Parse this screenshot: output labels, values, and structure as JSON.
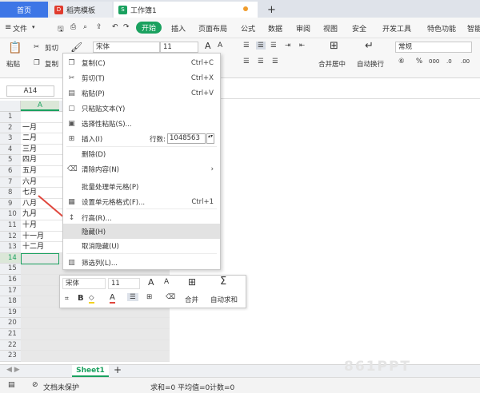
{
  "tabs": {
    "home": "首页",
    "template": "稻壳模板",
    "workbook": "工作簿1",
    "add": "+",
    "tpl_icon": "D",
    "wb_icon": "S"
  },
  "menubar": {
    "file": "文件",
    "start": "开始",
    "items": [
      "插入",
      "页面布局",
      "公式",
      "数据",
      "审阅",
      "视图",
      "安全",
      "开发工具",
      "特色功能",
      "智能"
    ]
  },
  "ribbon": {
    "paste": "粘贴",
    "cut": "剪切",
    "copy": "复制",
    "font_name": "宋体",
    "font_size": "11",
    "font_grow": "A",
    "font_shrink": "A",
    "merge": "合并居中",
    "wrap": "自动换行",
    "number_format": "常规",
    "percent": "%",
    "thousands": "000"
  },
  "formula": {
    "cell_ref": "A14"
  },
  "grid": {
    "col_a": "A",
    "rows": [
      "1",
      "2",
      "3",
      "4",
      "5",
      "6",
      "7",
      "8",
      "9",
      "10",
      "11",
      "12",
      "13",
      "14",
      "15",
      "16",
      "17",
      "18",
      "19",
      "20",
      "21",
      "22",
      "23"
    ],
    "values": [
      "",
      "一月",
      "二月",
      "三月",
      "四月",
      "五月",
      "六月",
      "七月",
      "八月",
      "九月",
      "十月",
      "十一月",
      "十二月",
      "",
      "",
      "",
      "",
      "",
      "",
      "",
      "",
      "",
      ""
    ]
  },
  "context_menu": {
    "items": [
      {
        "icon": "copy-icon",
        "glyph": "❐",
        "label": "复制(C)",
        "shortcut": "Ctrl+C"
      },
      {
        "icon": "scissors-icon",
        "glyph": "✂",
        "label": "剪切(T)",
        "shortcut": "Ctrl+X"
      },
      {
        "icon": "paste-icon",
        "glyph": "▤",
        "label": "粘贴(P)",
        "shortcut": "Ctrl+V"
      },
      {
        "icon": "paste-text-icon",
        "glyph": "▢",
        "label": "只粘贴文本(Y)",
        "shortcut": ""
      },
      {
        "icon": "paste-special-icon",
        "glyph": "▣",
        "label": "选择性粘贴(S)...",
        "shortcut": ""
      },
      {
        "icon": "insert-icon",
        "glyph": "⊞",
        "label": "插入(I)",
        "shortcut": ""
      },
      {
        "icon": "",
        "glyph": "",
        "label": "删除(D)",
        "shortcut": ""
      },
      {
        "icon": "eraser-icon",
        "glyph": "⌫",
        "label": "清除内容(N)",
        "shortcut": ""
      },
      {
        "icon": "",
        "glyph": "",
        "label": "批量处理单元格(P)",
        "shortcut": ""
      },
      {
        "icon": "format-cells-icon",
        "glyph": "▦",
        "label": "设置单元格格式(F)...",
        "shortcut": "Ctrl+1"
      },
      {
        "icon": "row-height-icon",
        "glyph": "↕",
        "label": "行高(R)...",
        "shortcut": ""
      },
      {
        "icon": "",
        "glyph": "",
        "label": "隐藏(H)",
        "shortcut": ""
      },
      {
        "icon": "",
        "glyph": "",
        "label": "取消隐藏(U)",
        "shortcut": ""
      },
      {
        "icon": "filter-icon",
        "glyph": "▥",
        "label": "筛选列(L)...",
        "shortcut": ""
      }
    ],
    "row_count_label": "行数:",
    "row_count_value": "1048563",
    "submenu_arrow": "›"
  },
  "mini_toolbar": {
    "font_name": "宋体",
    "font_size": "11",
    "bold": "B",
    "merge": "合并",
    "autosum": "自动求和",
    "a_grow": "A",
    "a_shrink": "A",
    "font_color": "A"
  },
  "sheetbar": {
    "sheet1": "Sheet1",
    "add": "+"
  },
  "status": {
    "protect": "文档未保护",
    "sum": "求和=0",
    "avg": "平均值=0",
    "count": "计数=0"
  },
  "watermark": "861PPT",
  "colors": {
    "accent": "#1aa15f",
    "arrow": "#e0473d",
    "highlight": "#e2e2e2"
  }
}
